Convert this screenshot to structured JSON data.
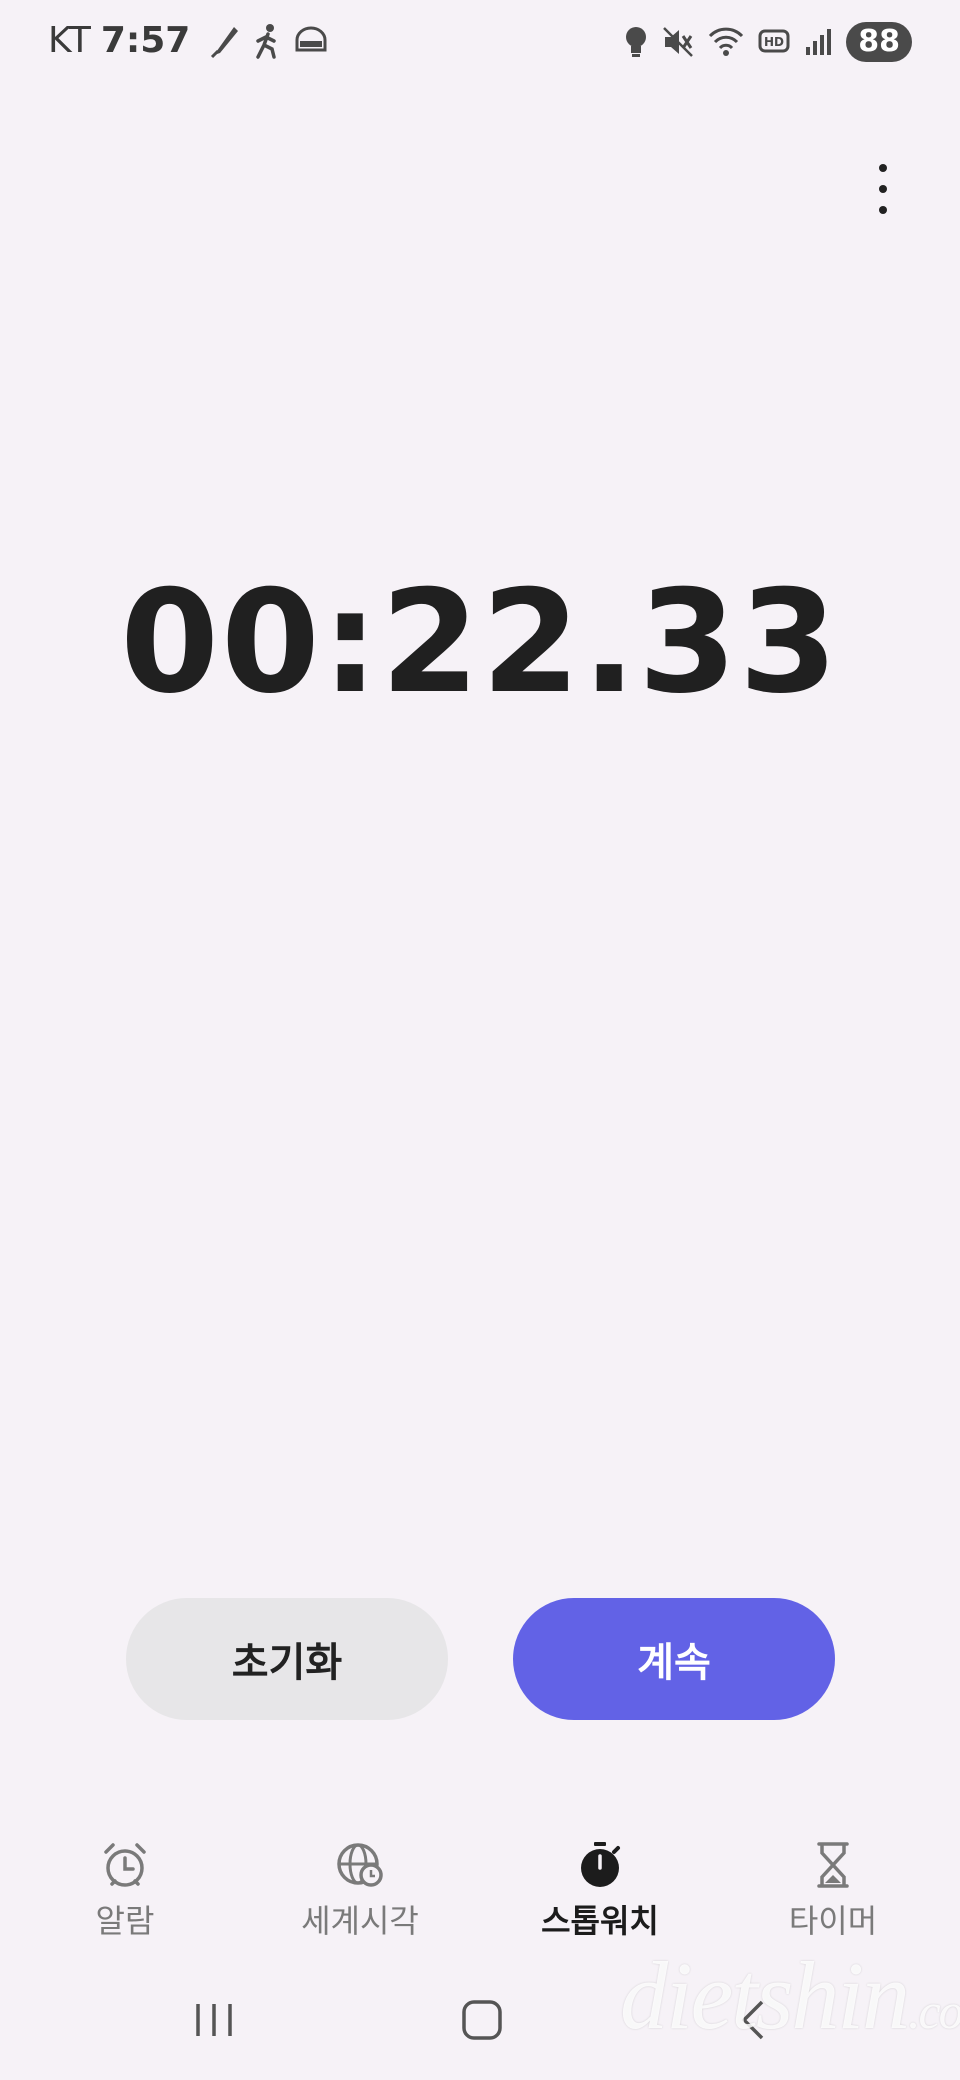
{
  "status_bar": {
    "carrier": "KT",
    "time": "7:57",
    "battery": "88",
    "left_icons": [
      "quill-icon",
      "walking-icon",
      "dash-badge-icon"
    ],
    "right_icons": [
      "bulb-icon",
      "mute-icon",
      "wifi-icon",
      "hd-icon",
      "signal-icon"
    ]
  },
  "stopwatch": {
    "time": "00:22.33"
  },
  "buttons": {
    "reset_label": "초기화",
    "continue_label": "계속"
  },
  "tabs": [
    {
      "label": "알람",
      "icon": "alarm-clock-icon",
      "active": false
    },
    {
      "label": "세계시각",
      "icon": "globe-clock-icon",
      "active": false
    },
    {
      "label": "스톱워치",
      "icon": "stopwatch-icon",
      "active": true
    },
    {
      "label": "타이머",
      "icon": "hourglass-icon",
      "active": false
    }
  ],
  "colors": {
    "background": "#f6f2f7",
    "accent": "#6262e6",
    "reset_button": "#e7e6e8"
  },
  "watermark": {
    "text": "dietshin",
    "suffix": ".com"
  }
}
